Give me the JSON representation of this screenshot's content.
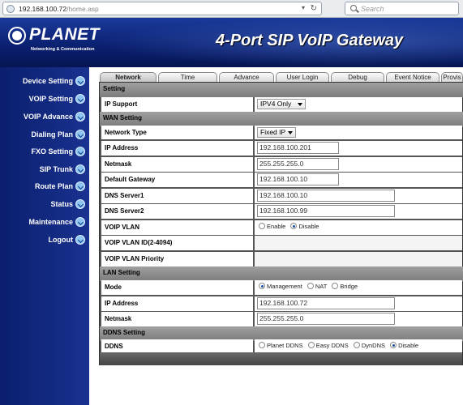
{
  "browser": {
    "url_main": "192.168.100.72",
    "url_path": "/home.asp",
    "search_placeholder": "Search"
  },
  "header": {
    "logo_text": "PLANET",
    "logo_tagline": "Networking & Communication",
    "title": "4-Port SIP VoIP Gateway"
  },
  "sidebar": {
    "items": [
      {
        "label": "Device Setting"
      },
      {
        "label": "VOIP Setting"
      },
      {
        "label": "VOIP Advance"
      },
      {
        "label": "Dialing Plan"
      },
      {
        "label": "FXO Setting"
      },
      {
        "label": "SIP Trunk"
      },
      {
        "label": "Route Plan"
      },
      {
        "label": "Status"
      },
      {
        "label": "Maintenance"
      },
      {
        "label": "Logout"
      }
    ]
  },
  "tabs": [
    {
      "label": "Network",
      "active": true
    },
    {
      "label": "Time"
    },
    {
      "label": "Advance"
    },
    {
      "label": "User Login"
    },
    {
      "label": "Debug"
    },
    {
      "label": "Event Notice"
    },
    {
      "label": "Provis"
    }
  ],
  "form": {
    "setting_section": "Setting",
    "ip_support_label": "IP Support",
    "ip_support_value": "IPV4 Only",
    "wan_section": "WAN Setting",
    "network_type_label": "Network Type",
    "network_type_value": "Fixed IP",
    "ip_address_label": "IP Address",
    "ip_address_value": "192.168.100.201",
    "netmask_label": "Netmask",
    "netmask_value": "255.255.255.0",
    "gateway_label": "Default Gateway",
    "gateway_value": "192.168.100.10",
    "dns1_label": "DNS Server1",
    "dns1_value": "192.168.100.10",
    "dns2_label": "DNS Server2",
    "dns2_value": "192.168.100.99",
    "voip_vlan_label": "VOIP VLAN",
    "voip_vlan_enable": "Enable",
    "voip_vlan_disable": "Disable",
    "voip_vlan_id_label": "VOIP VLAN ID(2-4094)",
    "voip_vlan_priority_label": "VOIP VLAN Priority",
    "lan_section": "LAN Setting",
    "mode_label": "Mode",
    "mode_management": "Management",
    "mode_nat": "NAT",
    "mode_bridge": "Bridge",
    "lan_ip_label": "IP Address",
    "lan_ip_value": "192.168.100.72",
    "lan_netmask_label": "Netmask",
    "lan_netmask_value": "255.255.255.0",
    "ddns_section": "DDNS Setting",
    "ddns_label": "DDNS",
    "ddns_planet": "Planet DDNS",
    "ddns_easy": "Easy DDNS",
    "ddns_dyndns": "DynDNS",
    "ddns_disable": "Disable"
  }
}
